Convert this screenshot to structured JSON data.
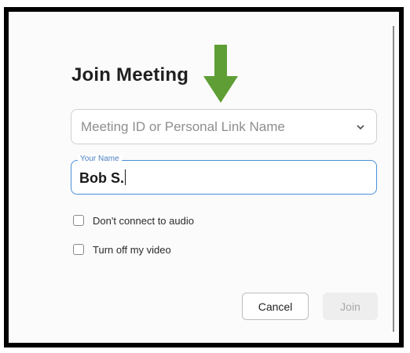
{
  "dialog": {
    "title": "Join Meeting",
    "meeting_id": {
      "placeholder": "Meeting ID or Personal Link Name",
      "value": ""
    },
    "name": {
      "label": "Your Name",
      "value": "Bob S."
    },
    "options": [
      {
        "label": "Don't connect to audio",
        "checked": false
      },
      {
        "label": "Turn off my video",
        "checked": false
      }
    ],
    "buttons": {
      "cancel": "Cancel",
      "join": "Join"
    }
  },
  "annotation": {
    "icon": "down-arrow-icon",
    "color": "#5f9e35"
  }
}
